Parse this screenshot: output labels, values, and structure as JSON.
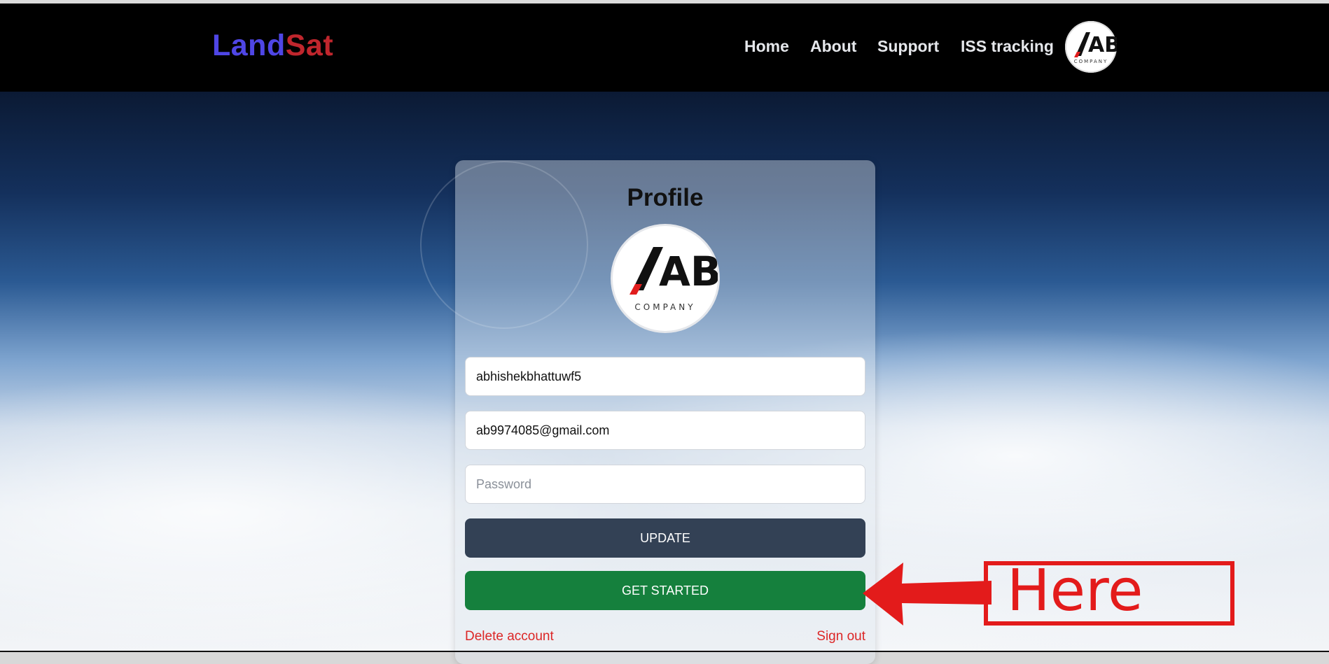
{
  "brand": {
    "part1": "Land",
    "part2": "Sat"
  },
  "nav": {
    "links": [
      "Home",
      "About",
      "Support",
      "ISS tracking"
    ],
    "avatar_logo": "AB",
    "avatar_sub": "COMPANY"
  },
  "profile": {
    "title": "Profile",
    "avatar_logo": "AB",
    "avatar_sub": "COMPANY",
    "username_value": "abhishekbhattuwf5",
    "email_value": "ab9974085@gmail.com",
    "password_placeholder": "Password",
    "update_label": "UPDATE",
    "get_started_label": "GET STARTED",
    "delete_label": "Delete account",
    "signout_label": "Sign out"
  },
  "annotation": {
    "text": "Here"
  },
  "colors": {
    "brand_land": "#4f46e5",
    "brand_sat": "#c0262d",
    "update_button": "#334155",
    "get_started_button": "#15803d",
    "link_red": "#dc2626",
    "annotation_red": "#e31b1b"
  },
  "icons": {
    "logo": "ab-company-logo-icon",
    "arrow": "annotation-arrow-icon"
  }
}
